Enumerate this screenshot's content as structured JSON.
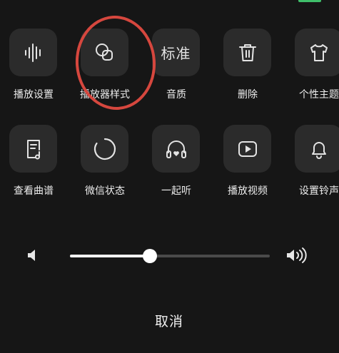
{
  "colors": {
    "background": "#161616",
    "tile": "#2b2b2b",
    "annotation_circle": "#d6473e",
    "slider_fill": "#f2f2f2",
    "slider_track": "#4a4a4a"
  },
  "menu": {
    "row1": [
      {
        "label": "播放设置",
        "icon": "waveform-icon"
      },
      {
        "label": "播放器样式",
        "icon": "overlapping-squares-icon"
      },
      {
        "label": "音质",
        "icon_text": "标准"
      },
      {
        "label": "删除",
        "icon": "trash-icon"
      },
      {
        "label": "个性主题",
        "icon": "tshirt-icon"
      }
    ],
    "row2": [
      {
        "label": "查看曲谱",
        "icon": "music-sheet-icon"
      },
      {
        "label": "微信状态",
        "icon": "circle-status-icon"
      },
      {
        "label": "一起听",
        "icon": "headphones-heart-icon"
      },
      {
        "label": "播放视频",
        "icon": "play-video-icon"
      },
      {
        "label": "设置铃声",
        "icon": "bell-icon"
      }
    ]
  },
  "volume": {
    "level": 0.4,
    "low_icon": "volume-low-icon",
    "high_icon": "volume-high-icon"
  },
  "cancel_label": "取消"
}
